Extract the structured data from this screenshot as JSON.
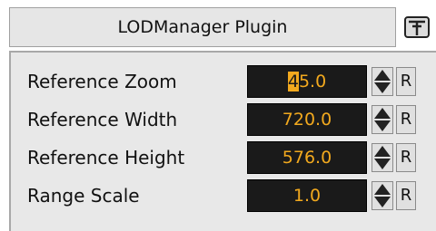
{
  "plugin": {
    "title": "LODManager Plugin",
    "logo_icon": "plugin-logo-icon"
  },
  "fields": [
    {
      "label": "Reference Zoom",
      "value_highlight": "4",
      "value_rest": "5.0",
      "reset_label": "R"
    },
    {
      "label": "Reference Width",
      "value": "720.0",
      "reset_label": "R"
    },
    {
      "label": "Reference Height",
      "value": "576.0",
      "reset_label": "R"
    },
    {
      "label": "Range Scale",
      "value": "1.0",
      "reset_label": "R"
    }
  ],
  "colors": {
    "field_bg": "#1a1a1a",
    "field_text": "#f2a91e",
    "panel_bg": "#e8e8e8"
  }
}
